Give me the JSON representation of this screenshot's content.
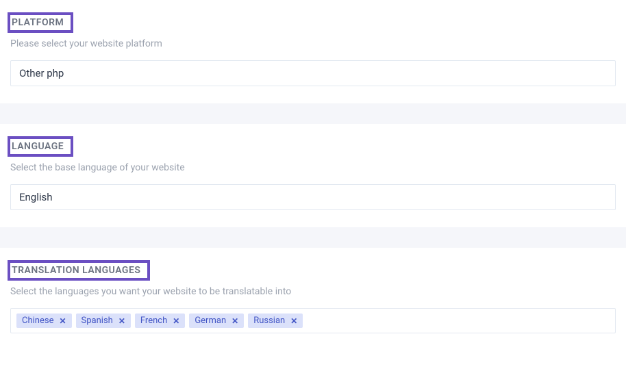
{
  "platform": {
    "title": "PLATFORM",
    "subtitle": "Please select your website platform",
    "selected": "Other php"
  },
  "language": {
    "title": "LANGUAGE",
    "subtitle": "Select the base language of your website",
    "selected": "English"
  },
  "translation_languages": {
    "title": "TRANSLATION LANGUAGES",
    "subtitle": "Select the languages you want your website to be translatable into",
    "tags": [
      "Chinese",
      "Spanish",
      "French",
      "German",
      "Russian"
    ]
  }
}
